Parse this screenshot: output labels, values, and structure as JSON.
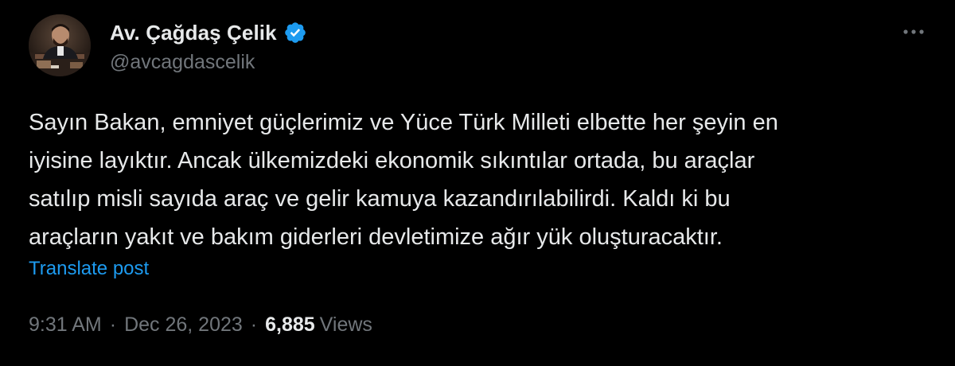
{
  "author": {
    "display_name": "Av. Çağdaş Çelik",
    "handle": "@avcagdascelik",
    "verified": true,
    "verified_badge_color": "#1d9bf0",
    "avatar_icon": "profile-photo"
  },
  "post": {
    "text_lines": [
      "Sayın Bakan, emniyet güçlerimiz ve Yüce Türk Milleti elbette her şeyin en",
      "iyisine layıktır. Ancak ülkemizdeki ekonomik sıkıntılar ortada, bu araçlar",
      "satılıp misli sayıda araç ve gelir kamuya kazandırılabilirdi. Kaldı ki bu",
      "araçların yakıt ve bakım giderleri devletimize ağır yük oluşturacaktır."
    ],
    "translate_label": "Translate post"
  },
  "meta": {
    "time": "9:31 AM",
    "separator": "·",
    "date": "Dec 26, 2023",
    "views_count": "6,885",
    "views_label": "Views"
  },
  "menu": {
    "more_icon": "more-horizontal-icon"
  },
  "colors": {
    "background": "#000000",
    "primary_text": "#e7e9ea",
    "secondary_text": "#71767b",
    "link": "#1d9bf0"
  }
}
